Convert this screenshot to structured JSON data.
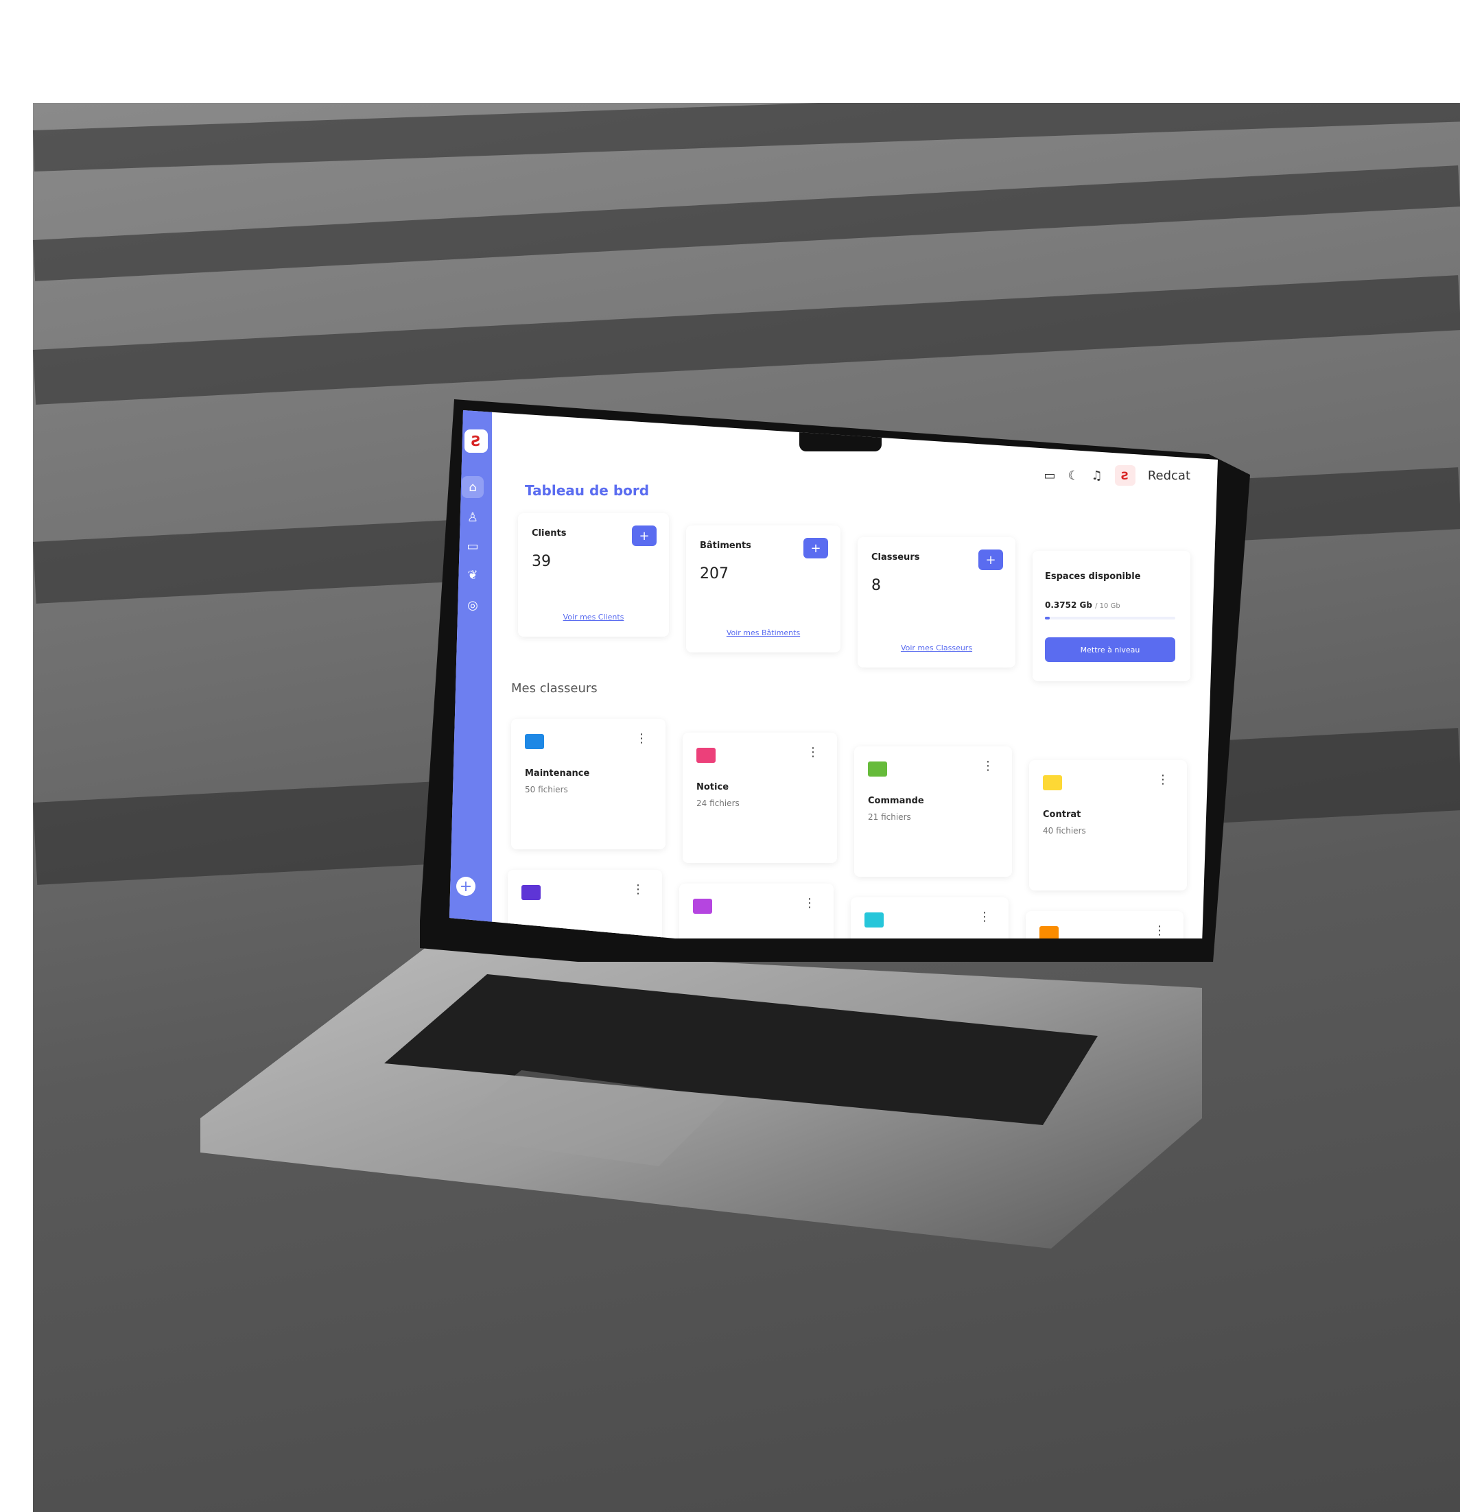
{
  "app": {
    "title": "Tableau de bord",
    "user": "Redcat",
    "logo": "Ƨ"
  },
  "icons": {
    "topbar": [
      "folder-icon",
      "moon-icon",
      "bell-icon"
    ],
    "sidebar": [
      "home-icon",
      "user-icon",
      "folder-icon",
      "leaf-icon",
      "settings-icon"
    ]
  },
  "stats": [
    {
      "title": "Clients",
      "value": "39",
      "link": "Voir mes Clients"
    },
    {
      "title": "Bâtiments",
      "value": "207",
      "link": "Voir mes Bâtiments"
    },
    {
      "title": "Classeurs",
      "value": "8",
      "link": "Voir mes Classeurs"
    }
  ],
  "storage": {
    "title": "Espaces disponible",
    "used": "0.3752 Gb",
    "total": "/ 10 Gb",
    "used_fraction": 0.0375,
    "button": "Mettre à niveau"
  },
  "section_title": "Mes classeurs",
  "folders": [
    {
      "name": "Maintenance",
      "count": "50 fichiers",
      "color": "#1e88e5"
    },
    {
      "name": "Notice",
      "count": "24 fichiers",
      "color": "#ec407a"
    },
    {
      "name": "Commande",
      "count": "21 fichiers",
      "color": "#66bb3a"
    },
    {
      "name": "Contrat",
      "count": "40 fichiers",
      "color": "#fdd835"
    },
    {
      "name": "",
      "count": "",
      "color": "#5e35d6"
    },
    {
      "name": "",
      "count": "",
      "color": "#b545e0"
    },
    {
      "name": "",
      "count": "",
      "color": "#26c6da"
    },
    {
      "name": "",
      "count": "",
      "color": "#fb8c00"
    }
  ],
  "colors": {
    "accent": "#5a6cf0",
    "sidebar": "#6d7ff0"
  }
}
